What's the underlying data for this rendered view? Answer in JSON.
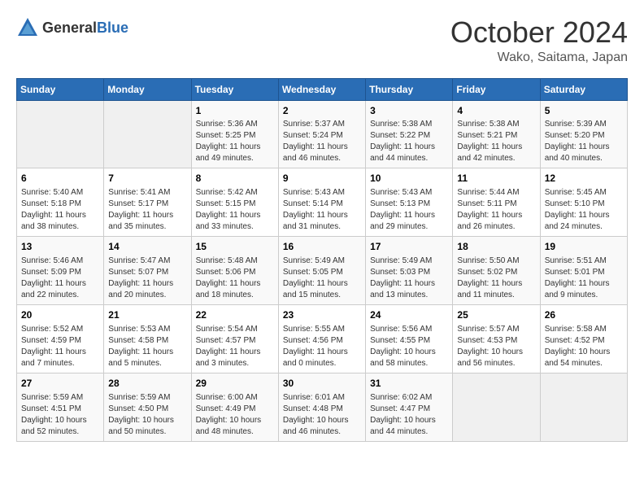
{
  "header": {
    "logo_general": "General",
    "logo_blue": "Blue",
    "month_title": "October 2024",
    "location": "Wako, Saitama, Japan"
  },
  "weekdays": [
    "Sunday",
    "Monday",
    "Tuesday",
    "Wednesday",
    "Thursday",
    "Friday",
    "Saturday"
  ],
  "weeks": [
    [
      {
        "day": "",
        "info": ""
      },
      {
        "day": "",
        "info": ""
      },
      {
        "day": "1",
        "info": "Sunrise: 5:36 AM\nSunset: 5:25 PM\nDaylight: 11 hours and 49 minutes."
      },
      {
        "day": "2",
        "info": "Sunrise: 5:37 AM\nSunset: 5:24 PM\nDaylight: 11 hours and 46 minutes."
      },
      {
        "day": "3",
        "info": "Sunrise: 5:38 AM\nSunset: 5:22 PM\nDaylight: 11 hours and 44 minutes."
      },
      {
        "day": "4",
        "info": "Sunrise: 5:38 AM\nSunset: 5:21 PM\nDaylight: 11 hours and 42 minutes."
      },
      {
        "day": "5",
        "info": "Sunrise: 5:39 AM\nSunset: 5:20 PM\nDaylight: 11 hours and 40 minutes."
      }
    ],
    [
      {
        "day": "6",
        "info": "Sunrise: 5:40 AM\nSunset: 5:18 PM\nDaylight: 11 hours and 38 minutes."
      },
      {
        "day": "7",
        "info": "Sunrise: 5:41 AM\nSunset: 5:17 PM\nDaylight: 11 hours and 35 minutes."
      },
      {
        "day": "8",
        "info": "Sunrise: 5:42 AM\nSunset: 5:15 PM\nDaylight: 11 hours and 33 minutes."
      },
      {
        "day": "9",
        "info": "Sunrise: 5:43 AM\nSunset: 5:14 PM\nDaylight: 11 hours and 31 minutes."
      },
      {
        "day": "10",
        "info": "Sunrise: 5:43 AM\nSunset: 5:13 PM\nDaylight: 11 hours and 29 minutes."
      },
      {
        "day": "11",
        "info": "Sunrise: 5:44 AM\nSunset: 5:11 PM\nDaylight: 11 hours and 26 minutes."
      },
      {
        "day": "12",
        "info": "Sunrise: 5:45 AM\nSunset: 5:10 PM\nDaylight: 11 hours and 24 minutes."
      }
    ],
    [
      {
        "day": "13",
        "info": "Sunrise: 5:46 AM\nSunset: 5:09 PM\nDaylight: 11 hours and 22 minutes."
      },
      {
        "day": "14",
        "info": "Sunrise: 5:47 AM\nSunset: 5:07 PM\nDaylight: 11 hours and 20 minutes."
      },
      {
        "day": "15",
        "info": "Sunrise: 5:48 AM\nSunset: 5:06 PM\nDaylight: 11 hours and 18 minutes."
      },
      {
        "day": "16",
        "info": "Sunrise: 5:49 AM\nSunset: 5:05 PM\nDaylight: 11 hours and 15 minutes."
      },
      {
        "day": "17",
        "info": "Sunrise: 5:49 AM\nSunset: 5:03 PM\nDaylight: 11 hours and 13 minutes."
      },
      {
        "day": "18",
        "info": "Sunrise: 5:50 AM\nSunset: 5:02 PM\nDaylight: 11 hours and 11 minutes."
      },
      {
        "day": "19",
        "info": "Sunrise: 5:51 AM\nSunset: 5:01 PM\nDaylight: 11 hours and 9 minutes."
      }
    ],
    [
      {
        "day": "20",
        "info": "Sunrise: 5:52 AM\nSunset: 4:59 PM\nDaylight: 11 hours and 7 minutes."
      },
      {
        "day": "21",
        "info": "Sunrise: 5:53 AM\nSunset: 4:58 PM\nDaylight: 11 hours and 5 minutes."
      },
      {
        "day": "22",
        "info": "Sunrise: 5:54 AM\nSunset: 4:57 PM\nDaylight: 11 hours and 3 minutes."
      },
      {
        "day": "23",
        "info": "Sunrise: 5:55 AM\nSunset: 4:56 PM\nDaylight: 11 hours and 0 minutes."
      },
      {
        "day": "24",
        "info": "Sunrise: 5:56 AM\nSunset: 4:55 PM\nDaylight: 10 hours and 58 minutes."
      },
      {
        "day": "25",
        "info": "Sunrise: 5:57 AM\nSunset: 4:53 PM\nDaylight: 10 hours and 56 minutes."
      },
      {
        "day": "26",
        "info": "Sunrise: 5:58 AM\nSunset: 4:52 PM\nDaylight: 10 hours and 54 minutes."
      }
    ],
    [
      {
        "day": "27",
        "info": "Sunrise: 5:59 AM\nSunset: 4:51 PM\nDaylight: 10 hours and 52 minutes."
      },
      {
        "day": "28",
        "info": "Sunrise: 5:59 AM\nSunset: 4:50 PM\nDaylight: 10 hours and 50 minutes."
      },
      {
        "day": "29",
        "info": "Sunrise: 6:00 AM\nSunset: 4:49 PM\nDaylight: 10 hours and 48 minutes."
      },
      {
        "day": "30",
        "info": "Sunrise: 6:01 AM\nSunset: 4:48 PM\nDaylight: 10 hours and 46 minutes."
      },
      {
        "day": "31",
        "info": "Sunrise: 6:02 AM\nSunset: 4:47 PM\nDaylight: 10 hours and 44 minutes."
      },
      {
        "day": "",
        "info": ""
      },
      {
        "day": "",
        "info": ""
      }
    ]
  ]
}
